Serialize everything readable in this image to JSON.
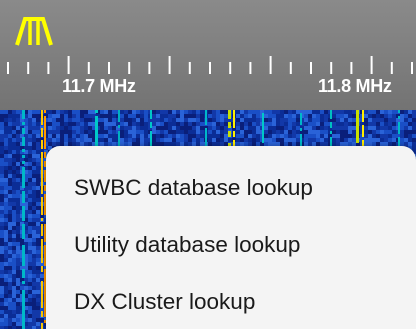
{
  "scale": {
    "labels": [
      "11.7 MHz",
      "11.8 MHz"
    ],
    "passband_icon": "passband-filter-icon",
    "colors": {
      "background": "#808080",
      "passband": "#ffff00",
      "ticks": "#ffffff"
    }
  },
  "context_menu": {
    "items": [
      {
        "label": "SWBC database lookup"
      },
      {
        "label": "Utility database lookup"
      },
      {
        "label": "DX Cluster lookup"
      }
    ]
  },
  "waterfall": {
    "colors": {
      "base": "#0d2a8c",
      "signal_low": "#00c8c8",
      "signal_high": "#ffee00"
    }
  }
}
